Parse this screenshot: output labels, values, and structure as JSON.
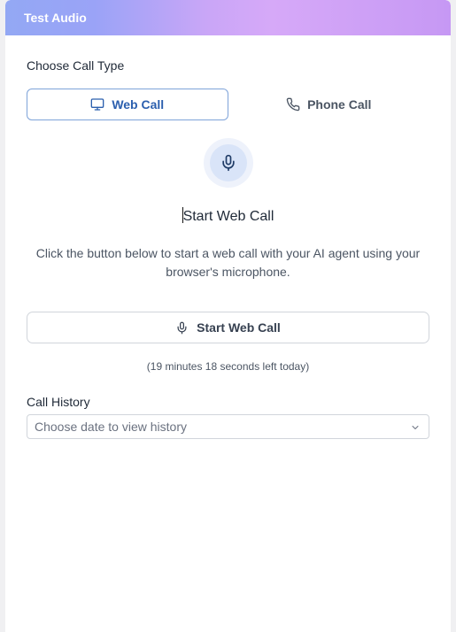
{
  "header": {
    "title": "Test Audio"
  },
  "call_type": {
    "label": "Choose Call Type",
    "options": [
      {
        "label": "Web Call",
        "icon": "monitor-icon",
        "active": true
      },
      {
        "label": "Phone Call",
        "icon": "phone-icon",
        "active": false
      }
    ]
  },
  "web_call": {
    "mic_icon": "microphone-icon",
    "title": "Start Web Call",
    "description": "Click the button below to start a web call with your AI agent using your browser's microphone.",
    "start_button_label": "Start Web Call",
    "time_left": "(19 minutes 18 seconds left today)"
  },
  "history": {
    "label": "Call History",
    "placeholder": "Choose date to view history"
  },
  "colors": {
    "accent": "#2b5fae",
    "accent_border": "#7ea3d9",
    "mic_bg": "#d9e4f8"
  }
}
